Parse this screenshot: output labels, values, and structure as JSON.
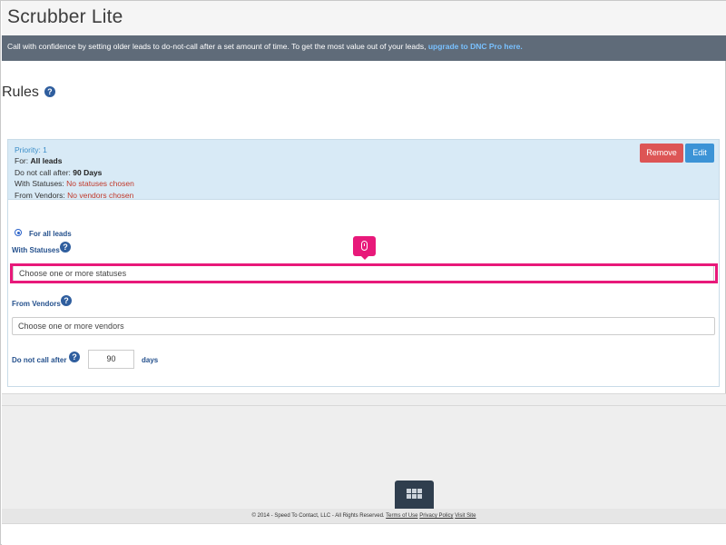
{
  "app": {
    "title": "Scrubber Lite"
  },
  "banner": {
    "text": "Call with confidence by setting older leads to do-not-call after a set amount of time. To get the most value out of your leads, ",
    "link_text": "upgrade to DNC Pro here."
  },
  "rules": {
    "heading": "Rules",
    "help_glyph": "?"
  },
  "rule_summary": {
    "priority_label": "Priority: ",
    "priority_value": "1",
    "for_label": "For: ",
    "for_value": "All leads",
    "dnc_after_label": "Do not call after: ",
    "dnc_after_value": "90 Days",
    "statuses_label": "With Statuses: ",
    "statuses_value": "No statuses chosen",
    "vendors_label": "From Vendors: ",
    "vendors_value": "No vendors chosen",
    "remove_label": "Remove",
    "edit_label": "Edit",
    "colors": {
      "remove": "#dd5555",
      "edit": "#3c93d6",
      "summary_bg": "#d8eaf6"
    }
  },
  "form": {
    "radio_label": "For all leads",
    "statuses_label": "With Statuses",
    "statuses_placeholder": "Choose one or more statuses",
    "vendors_label": "From Vendors",
    "vendors_placeholder": "Choose one or more vendors",
    "dnc_after_label": "Do not call after",
    "days_value": "90",
    "days_unit": "days"
  },
  "overlay": {
    "cursor_icon": "mouse-icon",
    "highlight_color": "#e8197a"
  },
  "footer": {
    "copyright": "© 2014 - Speed To Contact, LLC - All Rights Reserved.",
    "terms_link": "Terms of Use",
    "privacy_link": "Privacy Policy",
    "visit_link": "Visit Site",
    "grid_icon": "grid-icon"
  }
}
